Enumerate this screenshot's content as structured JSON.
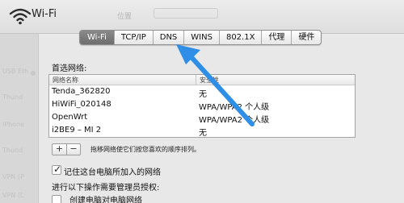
{
  "window": {
    "title": "Wi-Fi",
    "faint_header_text": "位置"
  },
  "background_sidebar": {
    "items": [
      "USB Eth",
      "Thund",
      "iPhone",
      "Thund",
      "VPN (P",
      "VPN (L"
    ]
  },
  "tabs": [
    {
      "label": "Wi-Fi",
      "active": true
    },
    {
      "label": "TCP/IP",
      "active": false
    },
    {
      "label": "DNS",
      "active": false
    },
    {
      "label": "WINS",
      "active": false
    },
    {
      "label": "802.1X",
      "active": false
    },
    {
      "label": "代理",
      "active": false
    },
    {
      "label": "硬件",
      "active": false
    }
  ],
  "preferred_networks": {
    "label": "首选网络:",
    "columns": [
      "网络名称",
      "安全性"
    ],
    "rows": [
      {
        "name": "Tenda_362820",
        "security": "无"
      },
      {
        "name": "HiWiFi_020148",
        "security": "WPA/WPA2 个人级"
      },
      {
        "name": "OpenWrt",
        "security": "WPA/WPA2 个人级"
      },
      {
        "name": "i2BE9 – MI 2",
        "security": "无"
      }
    ]
  },
  "list_buttons": {
    "add": "+",
    "remove": "−"
  },
  "drag_hint": "拖移网络使它们按您喜欢的顺序排列。",
  "remember": {
    "label": "记住这台电脑所加入的网络",
    "checked": true
  },
  "admin_section": {
    "label": "进行以下操作需要管理员授权:"
  },
  "create_computer_network": {
    "label": "创建电脑对电脑网络",
    "checked": false
  },
  "annotation": {
    "color": "#2f8fe6"
  }
}
